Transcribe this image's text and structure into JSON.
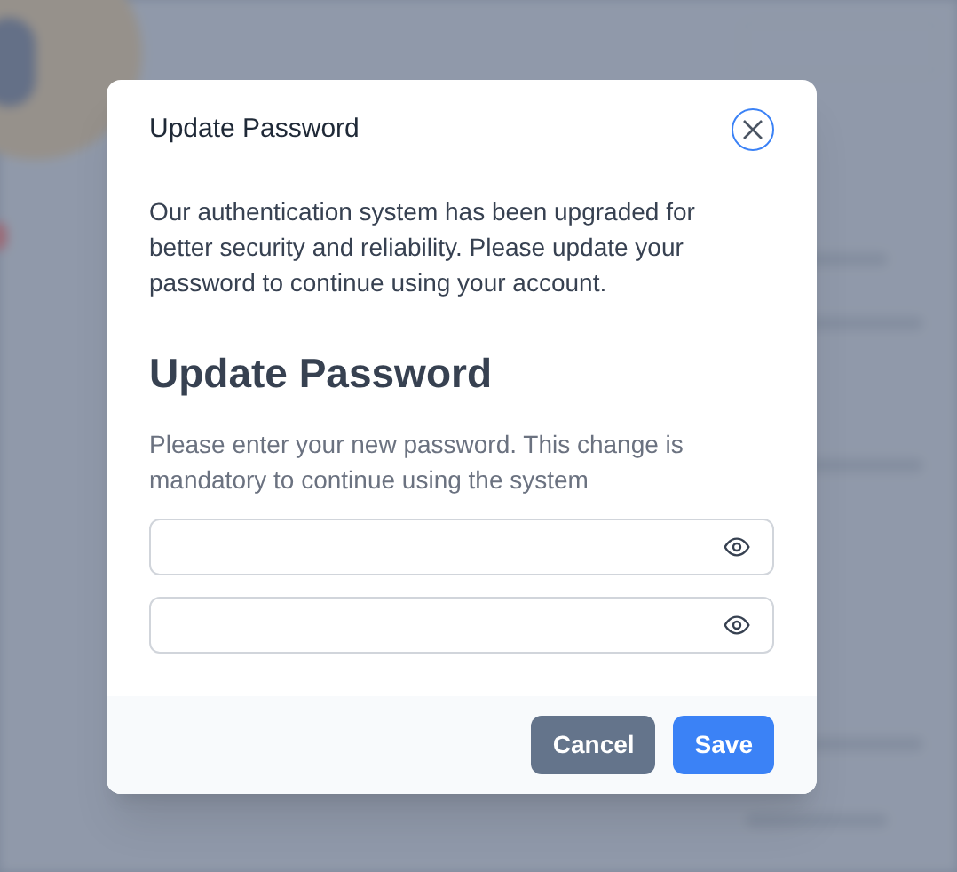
{
  "dialog": {
    "title": "Update Password",
    "intro": "Our authentication system has been upgraded for better security and reliability. Please update your password to continue using your account.",
    "heading": "Update Password",
    "instructions": "Please enter your new password. This change is mandatory to continue using the system",
    "fields": [
      {
        "kind": "password"
      },
      {
        "kind": "password"
      }
    ],
    "buttons": [
      {
        "label": "Cancel",
        "kind": "secondary"
      },
      {
        "label": "Save",
        "kind": "primary"
      }
    ]
  }
}
